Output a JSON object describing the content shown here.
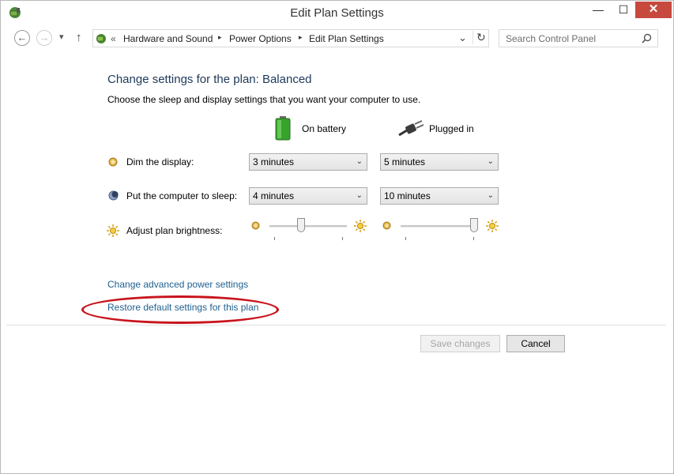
{
  "window": {
    "title": "Edit Plan Settings"
  },
  "controls": {
    "minimize": "—",
    "maximize": "☐",
    "close": "✕"
  },
  "nav": {
    "back": "←",
    "forward": "→",
    "dropdown": "▾",
    "up": "↑"
  },
  "address": {
    "prefix": "«",
    "crumbs": [
      "Hardware and Sound",
      "Power Options",
      "Edit Plan Settings"
    ],
    "separator": "▸",
    "dropdown": "⌄",
    "refresh": "↻"
  },
  "search": {
    "placeholder": "Search Control Panel",
    "icon": "⚲"
  },
  "content": {
    "heading": "Change settings for the plan: Balanced",
    "subtitle": "Choose the sleep and display settings that you want your computer to use.",
    "col_battery": "On battery",
    "col_plugged": "Plugged in",
    "rows": {
      "dim": {
        "label": "Dim the display:",
        "battery": "3 minutes",
        "plugged": "5 minutes"
      },
      "sleep": {
        "label": "Put the computer to sleep:",
        "battery": "4 minutes",
        "plugged": "10 minutes"
      },
      "brightness": {
        "label": "Adjust plan brightness:",
        "battery_level": 0.4,
        "plugged_level": 1.0
      }
    },
    "links": {
      "advanced": "Change advanced power settings",
      "restore": "Restore default settings for this plan"
    }
  },
  "buttons": {
    "save": "Save changes",
    "cancel": "Cancel"
  },
  "colors": {
    "heading": "#1e395b",
    "link": "#1e5f8f",
    "highlight_oval": "#c8141c"
  }
}
